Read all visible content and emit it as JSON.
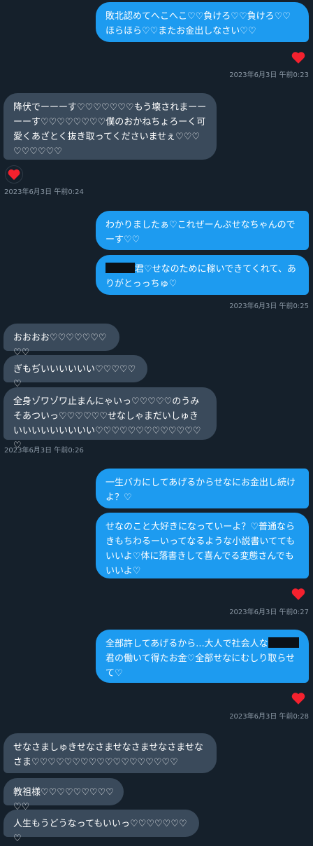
{
  "messages": [
    {
      "text": "敗北認めてへこへこ♡♡負けろ♡♡負けろ♡♡ほらほら♡♡またお金出しなさい♡♡"
    },
    {
      "text": "降伏でーーーす♡♡♡♡♡♡♡もう壊されまーーーーす♡♡♡♡♡♡♡♡僕のおかねちょろーく可愛くあざとく抜き取ってくださいませぇ♡♡♡♡♡♡♡♡♡"
    },
    {
      "text": "わかりましたぁ♡これぜーんぶせなちゃんのでーす♡♡"
    },
    {
      "text_after": "君♡せなのために稼いできてくれて、ありがとっっちゅ♡"
    },
    {
      "text": "おおおお♡♡♡♡♡♡♡♡♡"
    },
    {
      "text": "ぎもぢいいいいいい♡♡♡♡♡♡"
    },
    {
      "text": "全身ゾワゾワ止まんにゃいっ♡♡♡♡♡のうみそあついっ♡♡♡♡♡♡せなしゃまだいしゅきいいいいいいいいい♡♡♡♡♡♡♡♡♡♡♡♡♡♡"
    },
    {
      "text": "一生バカにしてあげるからせなにお金出し続けよ？♡"
    },
    {
      "text": "せなのこと大好きになっていーよ？♡普通ならきもちわるーいってなるような小説書いててもいいよ♡体に落書きして喜んでる変態さんでもいいよ♡"
    },
    {
      "text_before": "全部許してあげるから...大人で社会人な",
      "text_after": "君の働いて得たお金♡全部せなにむしり取らせて♡"
    },
    {
      "text": "せなさましゅきせなさませなさませなさませなさま♡♡♡♡♡♡♡♡♡♡♡♡♡♡♡♡♡♡"
    },
    {
      "text": "教祖様♡♡♡♡♡♡♡♡♡♡♡"
    },
    {
      "text": "人生もうどうなってもいいっ♡♡♡♡♡♡♡♡"
    }
  ],
  "timestamps": {
    "t1": "2023年6月3日 午前0:23",
    "t2": "2023年6月3日 午前0:24",
    "t3": "2023年6月3日 午前0:25",
    "t4": "2023年6月3日 午前0:26",
    "t5": "2023年6月3日 午前0:27",
    "t6": "2023年6月3日 午前0:28"
  },
  "colors": {
    "background": "#15202b",
    "outgoing": "#1d9bf0",
    "incoming": "#3a4a5b",
    "heart": "#f91880",
    "timestamp": "#8b98a5"
  },
  "icons": [
    "heart-icon"
  ]
}
